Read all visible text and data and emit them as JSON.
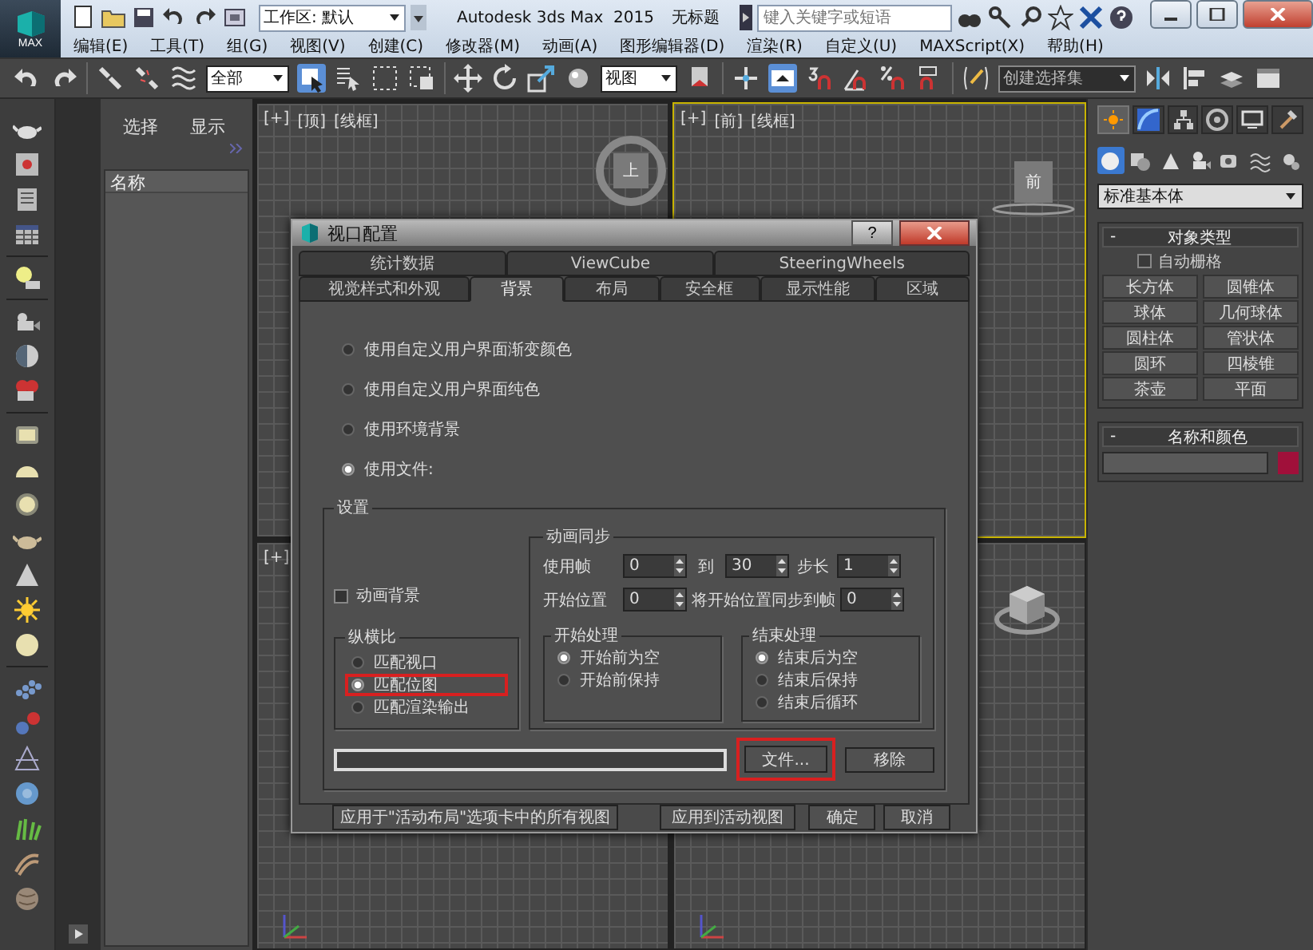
{
  "title_bar": {
    "logo": "MAX",
    "workspace": "工作区: 默认",
    "app_title": "Autodesk 3ds Max  2015",
    "document": "无标题",
    "search": {
      "placeholder": "键入关键字或短语"
    }
  },
  "menu": [
    "编辑(E)",
    "工具(T)",
    "组(G)",
    "视图(V)",
    "创建(C)",
    "修改器(M)",
    "动画(A)",
    "图形编辑器(D)",
    "渲染(R)",
    "自定义(U)",
    "MAXScript(X)",
    "帮助(H)"
  ],
  "toolbar": {
    "selection_filter": "全部",
    "reference_coordinate": "视图",
    "named_selection": {
      "placeholder": "创建选择集"
    }
  },
  "scene_explorer": {
    "tabs": [
      "选择",
      "显示"
    ],
    "column": "名称"
  },
  "viewports": [
    {
      "labels": [
        "[+]",
        "[顶]",
        "[线框]"
      ],
      "active": false,
      "viewcube": {
        "kind": "ring",
        "label": "上"
      }
    },
    {
      "labels": [
        "[+]",
        "[前]",
        "[线框]"
      ],
      "active": true,
      "viewcube": {
        "kind": "plate",
        "label": "前"
      }
    },
    {
      "labels": [
        "[+]"
      ],
      "active": false
    },
    {
      "active": false,
      "viewcube": {
        "kind": "cube"
      }
    }
  ],
  "command_panel": {
    "tabs": [
      {
        "selected": true
      },
      {
        "selected": false
      },
      {
        "selected": false
      },
      {
        "selected": false
      },
      {
        "selected": false
      },
      {
        "selected": false
      }
    ],
    "categories": [
      {
        "selected": true
      },
      {
        "selected": false
      },
      {
        "selected": false
      },
      {
        "selected": false
      },
      {
        "selected": false
      },
      {
        "selected": false
      },
      {
        "selected": false
      }
    ],
    "type_dropdown": "标准基本体",
    "object_type": {
      "toggle": "-",
      "title": "对象类型",
      "auto_grid": {
        "label": "自动栅格",
        "checked": false
      },
      "buttons": [
        "长方体",
        "圆锥体",
        "球体",
        "几何球体",
        "圆柱体",
        "管状体",
        "圆环",
        "四棱锥",
        "茶壶",
        "平面"
      ]
    },
    "name_and_color": {
      "toggle": "-",
      "title": "名称和颜色",
      "color": "#a0103a"
    }
  },
  "dialog": {
    "title": "视口配置",
    "help": "?",
    "tab_rows": [
      [
        {
          "label": "统计数据",
          "selected": false
        },
        {
          "label": "ViewCube",
          "selected": false
        },
        {
          "label": "SteeringWheels",
          "selected": false
        }
      ],
      [
        {
          "label": "视觉样式和外观",
          "selected": false
        },
        {
          "label": "背景",
          "selected": true
        },
        {
          "label": "布局",
          "selected": false
        },
        {
          "label": "安全框",
          "selected": false
        },
        {
          "label": "显示性能",
          "selected": false
        },
        {
          "label": "区域",
          "selected": false
        }
      ]
    ],
    "background_options": [
      {
        "label": "使用自定义用户界面渐变颜色",
        "selected": false
      },
      {
        "label": "使用自定义用户界面纯色",
        "selected": false
      },
      {
        "label": "使用环境背景",
        "selected": false
      },
      {
        "label": "使用文件:",
        "selected": true
      }
    ],
    "settings": {
      "title": "设置",
      "animate_background": {
        "label": "动画背景",
        "checked": false
      },
      "aspect_ratio": {
        "title": "纵横比",
        "options": [
          {
            "label": "匹配视口",
            "selected": false,
            "highlighted": false
          },
          {
            "label": "匹配位图",
            "selected": true,
            "highlighted": true
          },
          {
            "label": "匹配渲染输出",
            "selected": false,
            "highlighted": false
          }
        ]
      },
      "animation_sync": {
        "title": "动画同步",
        "use_frames_label": "使用帧",
        "from": "0",
        "to_label": "到",
        "to": "30",
        "step_label": "步长",
        "step": "1",
        "start_label": "开始位置",
        "start": "0",
        "sync_label": "将开始位置同步到帧",
        "sync": "0",
        "start_processing": {
          "title": "开始处理",
          "options": [
            {
              "label": "开始前为空",
              "selected": true
            },
            {
              "label": "开始前保持",
              "selected": false
            }
          ]
        },
        "end_processing": {
          "title": "结束处理",
          "options": [
            {
              "label": "结束后为空",
              "selected": true
            },
            {
              "label": "结束后保持",
              "selected": false
            },
            {
              "label": "结束后循环",
              "selected": false
            }
          ]
        }
      },
      "file_button": {
        "label": "文件...",
        "highlighted": true
      },
      "remove_button": "移除"
    },
    "buttons": [
      "应用于\"活动布局\"选项卡中的所有视图",
      "应用到活动视图",
      "确定",
      "取消"
    ]
  }
}
